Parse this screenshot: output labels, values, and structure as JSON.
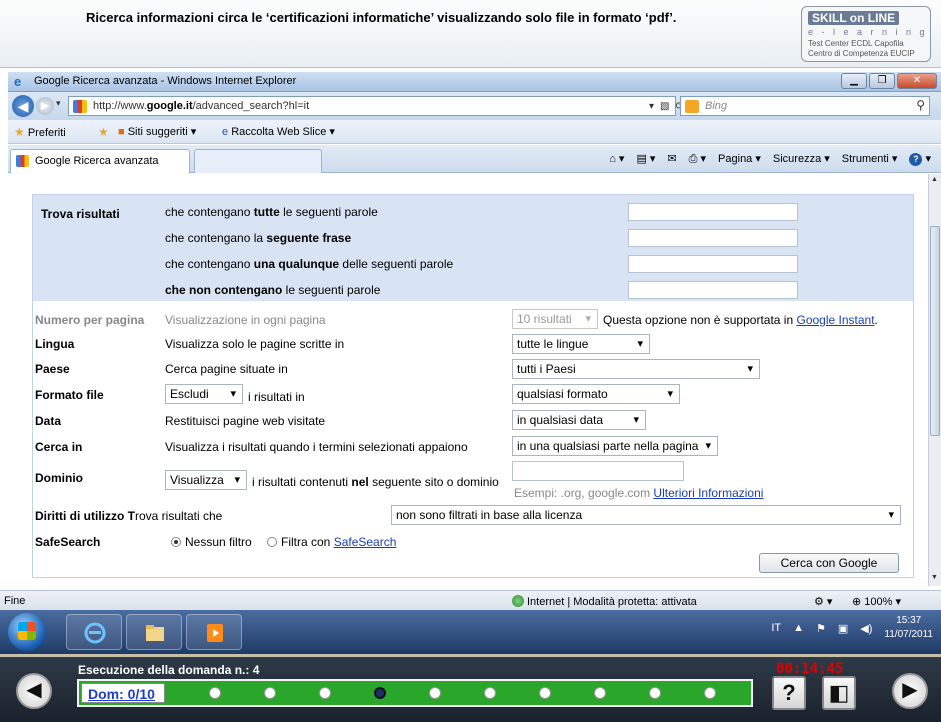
{
  "banner": {
    "question": "Ricerca informazioni circa le ‘certificazioni informatiche’ visualizzando solo file in formato ‘pdf’.",
    "logo": {
      "line1": "SKILL on LINE",
      "line2": "e - l e a r n i n g",
      "line3": "Test Center ECDL Capofila",
      "line4": "Centro di Competenza EUCIP"
    }
  },
  "browser": {
    "window_title": "Google Ricerca avanzata - Windows Internet Explorer",
    "url_prefix": "http://www.",
    "url_domain": "google.it",
    "url_path": "/advanced_search?hl=it",
    "search_provider": "Bing",
    "favorites": {
      "preferiti": "Preferiti",
      "siti_suggeriti": "Siti suggeriti ▾",
      "raccolta": "Raccolta Web Slice ▾"
    },
    "tab_label": "Google Ricerca avanzata",
    "commands": {
      "pagina": "Pagina ▾",
      "sicurezza": "Sicurezza ▾",
      "strumenti": "Strumenti ▾"
    }
  },
  "form": {
    "find_label": "Trova risultati",
    "all_words_pre": "che contengano ",
    "all_words_bold": "tutte",
    "all_words_post": " le seguenti parole",
    "phrase_pre": "che contengano la ",
    "phrase_bold": "seguente frase",
    "any_pre": "che contengano ",
    "any_bold": "una qualunque",
    "any_post": " delle seguenti parole",
    "none_bold": "che non contengano",
    "none_post": " le seguenti parole",
    "per_page_label": "Numero per pagina",
    "per_page_desc": "Visualizzazione in ogni pagina",
    "per_page_value": "10 risultati",
    "instant_note": "Questa opzione non è supportata in ",
    "instant_link": "Google Instant",
    "lingua_label": "Lingua",
    "lingua_desc": "Visualizza solo le pagine scritte in",
    "lingua_value": "tutte le lingue",
    "paese_label": "Paese",
    "paese_desc": "Cerca pagine situate in",
    "paese_value": "tutti i Paesi",
    "formato_label": "Formato file",
    "formato_mode": "Escludi",
    "formato_desc": "i risultati in",
    "formato_value": "qualsiasi formato",
    "data_label": "Data",
    "data_desc": "Restituisci pagine web visitate",
    "data_value": "in qualsiasi data",
    "cercain_label": "Cerca in",
    "cercain_desc": "Visualizza i risultati quando i termini selezionati appaiono",
    "cercain_value": "in una qualsiasi parte nella pagina",
    "dominio_label": "Dominio",
    "dominio_mode": "Visualizza",
    "dominio_desc_pre": "i risultati contenuti ",
    "dominio_desc_bold": "nel",
    "dominio_desc_post": " seguente sito o dominio",
    "dominio_example": "Esempi: .org, google.com ",
    "dominio_link": "Ulteriori Informazioni",
    "diritti_label": "Diritti di utilizzo T",
    "diritti_label_rest": "rova risultati che",
    "diritti_value": "non sono filtrati in base alla licenza",
    "safe_label": "SafeSearch",
    "safe_off": "Nessun filtro",
    "safe_on_pre": "Filtra con ",
    "safe_on_link": "SafeSearch",
    "submit": "Cerca con Google"
  },
  "status": {
    "left": "Fine",
    "zone": "Internet | Modalità protetta: attivata",
    "zoom": "100%"
  },
  "taskbar": {
    "lang": "IT",
    "time": "15:37",
    "date": "11/07/2011"
  },
  "exam": {
    "question_number": "Esecuzione della domanda n.: 4",
    "timer": "00:14:45",
    "dom": "Dom: 0/10",
    "dot_count": 10,
    "current_dot": 4,
    "help": "?"
  },
  "colors": {
    "find_bg": "#d8e4f4",
    "progress_bg": "#2aa72a",
    "timer": "#e00000",
    "link": "#1a3db6"
  }
}
